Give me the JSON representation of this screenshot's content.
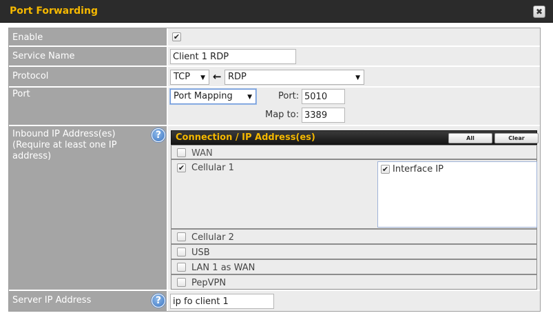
{
  "dialog": {
    "title": "Port Forwarding",
    "close_icon": "✖"
  },
  "form": {
    "enable": {
      "label": "Enable",
      "checked": true
    },
    "service_name": {
      "label": "Service Name",
      "value": "Client 1 RDP"
    },
    "protocol": {
      "label": "Protocol",
      "value": "TCP",
      "arrow_icon": "←",
      "service": "RDP"
    },
    "port": {
      "label": "Port",
      "mode": "Port Mapping",
      "port_label": "Port:",
      "port_value": "5010",
      "map_label": "Map to:",
      "map_value": "3389"
    },
    "inbound": {
      "label": "Inbound IP Address(es)\n(Require at least one IP address)",
      "help_icon": "?",
      "header_title": "Connection / IP Address(es)",
      "all_label": "All",
      "clear_label": "Clear",
      "connections": [
        {
          "name": "WAN",
          "checked": false
        },
        {
          "name": "Cellular 1",
          "checked": true,
          "sub": "Interface IP",
          "sub_checked": true
        },
        {
          "name": "Cellular 2",
          "checked": false
        },
        {
          "name": "USB",
          "checked": false
        },
        {
          "name": "LAN 1 as WAN",
          "checked": false
        },
        {
          "name": "PepVPN",
          "checked": false
        }
      ]
    },
    "server_ip": {
      "label": "Server IP Address",
      "help_icon": "?",
      "value": "ip fo client 1"
    }
  },
  "colors": {
    "title_accent": "#f5b800",
    "label_bg": "#a5a5a5",
    "value_bg": "#ececec"
  }
}
